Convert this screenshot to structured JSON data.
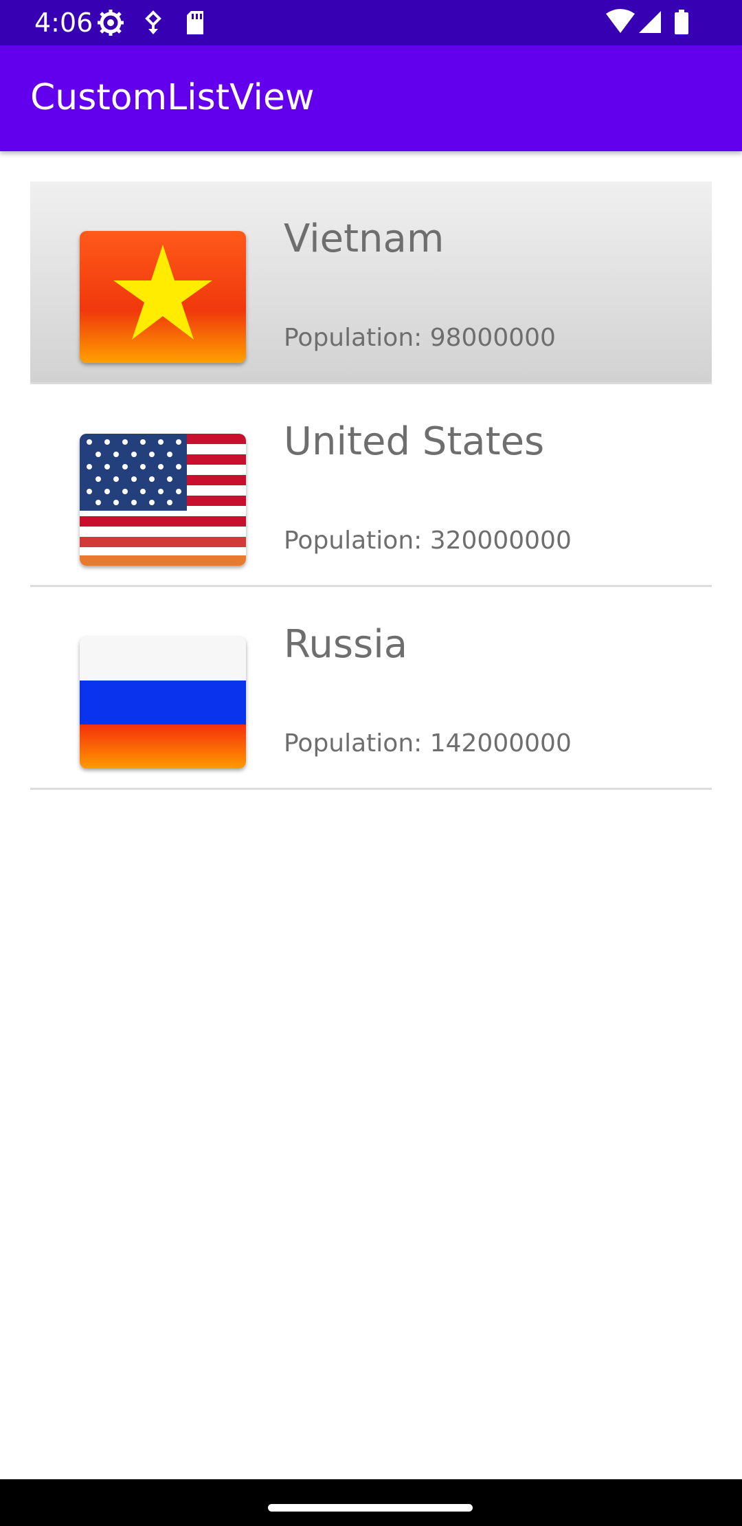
{
  "status_bar": {
    "time": "4:06",
    "left_icons": [
      "gear-icon",
      "usb-debug-icon",
      "sd-card-icon"
    ],
    "right_icons": [
      "wifi-icon",
      "signal-icon",
      "battery-icon"
    ],
    "color": "#3700b3"
  },
  "app_bar": {
    "title": "CustomListView",
    "color": "#6200ee"
  },
  "countries": [
    {
      "name": "Vietnam",
      "population": "Population: 98000000",
      "flag": "vietnam-flag-icon",
      "selected": true
    },
    {
      "name": "United States",
      "population": "Population: 320000000",
      "flag": "us-flag-icon",
      "selected": false
    },
    {
      "name": "Russia",
      "population": "Population: 142000000",
      "flag": "russia-flag-icon",
      "selected": false
    }
  ],
  "navigation_bar": {
    "handle": "home-gesture-handle"
  }
}
